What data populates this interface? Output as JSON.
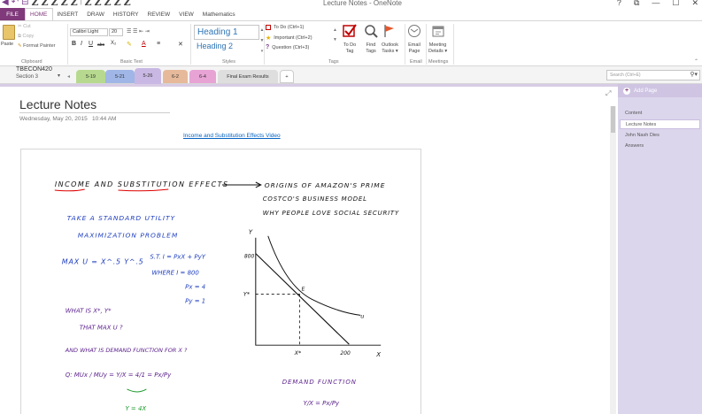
{
  "window": {
    "title": "Lecture Notes - OneNote",
    "controls": [
      "?",
      "⧉",
      "—",
      "☐",
      "✕"
    ]
  },
  "quick_access": {
    "icons": [
      "back-icon",
      "undo-icon",
      "dock-icon"
    ],
    "pen_glyphs": [
      "Z",
      "Z",
      "Z",
      "Z",
      "Z",
      "Z",
      "Z",
      "Z",
      "Z",
      "Z"
    ]
  },
  "tabs": {
    "file": "FILE",
    "items": [
      "HOME",
      "INSERT",
      "DRAW",
      "HISTORY",
      "REVIEW",
      "VIEW",
      "Mathematics"
    ],
    "active": "HOME"
  },
  "ribbon": {
    "clipboard": {
      "paste": "Paste",
      "cut": "Cut",
      "copy": "Copy",
      "format_painter": "Format Painter",
      "label": "Clipboard"
    },
    "basic_text": {
      "font": "Calibri Light",
      "size": "20",
      "label": "Basic Text",
      "format_glyphs": [
        "B",
        "I",
        "U",
        "abc",
        "X₂",
        "✎",
        "A",
        "≡",
        "✕"
      ]
    },
    "styles": {
      "heading1": "Heading 1",
      "heading2": "Heading 2",
      "label": "Styles"
    },
    "tags": {
      "items": [
        "To Do (Ctrl+1)",
        "Important (Ctrl+2)",
        "Question (Ctrl+3)"
      ],
      "label": "Tags"
    },
    "buttons": {
      "todo_tag": [
        "To Do",
        "Tag"
      ],
      "find_tags": [
        "Find",
        "Tags"
      ],
      "outlook_tasks": [
        "Outlook",
        "Tasks ▾"
      ],
      "email_page": [
        "Email",
        "Page"
      ],
      "meeting_details": [
        "Meeting",
        "Details ▾"
      ]
    },
    "email_label": "Email",
    "meetings_label": "Meetings"
  },
  "notebook": {
    "name": "TBECON420",
    "section_label": "Section 3",
    "sections": [
      {
        "label": "5-19",
        "color": "#b6d98f"
      },
      {
        "label": "5-21",
        "color": "#9fb6e6"
      },
      {
        "label": "5-26",
        "color": "#c9b8e3"
      },
      {
        "label": "6-2",
        "color": "#e6b99a"
      },
      {
        "label": "6-4",
        "color": "#e8a3d5"
      },
      {
        "label": "Final Exam Results",
        "color": "#dedede"
      }
    ],
    "add_tab": "+",
    "search_placeholder": "Search (Ctrl+E)"
  },
  "page": {
    "title": "Lecture Notes",
    "date": "Wednesday, May 20, 2015",
    "time": "10:44 AM",
    "link": "Income and Substitution Effects Video"
  },
  "ink_notes": {
    "heading": "INCOME AND SUBSTITUTION EFFECTS",
    "side_notes": [
      "ORIGINS OF AMAZON'S PRIME",
      "COSTCO'S BUSINESS MODEL",
      "WHY PEOPLE LOVE SOCIAL SECURITY"
    ],
    "lines": [
      "TAKE A STANDARD UTILITY",
      "MAXIMIZATION PROBLEM",
      "MAX U = X^.5 Y^.5",
      "S.T. I = PxX + PyY",
      "WHERE I = 800",
      "Px = 4",
      "Py = 1",
      "WHAT IS X*, Y*",
      "THAT MAX U ?",
      "AND WHAT IS DEMAND FUNCTION FOR X ?",
      "Q: MUx / MUy = Y/X = 4/1 = Px/Py",
      "Y = 4X",
      "DEMAND FUNCTION",
      "Y/X = Px/Py"
    ],
    "graph": {
      "y_axis": "Y",
      "x_axis": "X",
      "y_tick": "800",
      "x_tick": "200",
      "y_star": "Y*",
      "x_star": "X*",
      "point": "E",
      "curve": "u"
    }
  },
  "pages_panel": {
    "add_page": "Add Page",
    "items": [
      "Content",
      "Lecture Notes",
      "John Nash Dies",
      "Answers"
    ],
    "active": "Lecture Notes"
  }
}
